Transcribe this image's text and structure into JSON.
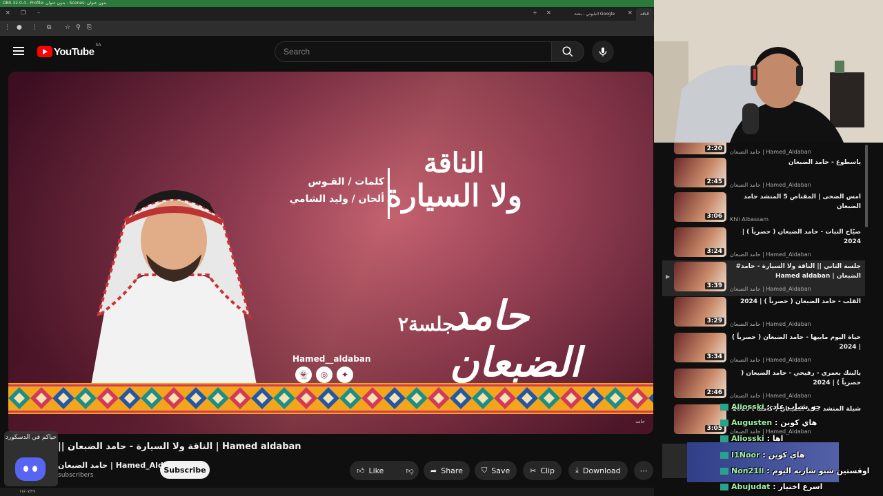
{
  "obs": {
    "title": "OBS 32.0.4 - Profile: بدون عنوان - Scenes: بدون عنوان"
  },
  "browser": {
    "tabs": [
      {
        "label": "البابوتي - بحث Google",
        "close": "×"
      },
      {
        "label": "الناقة",
        "close": "×"
      }
    ],
    "new_tab": "+"
  },
  "youtube": {
    "logo_text": "YouTube",
    "country_code": "SA",
    "search_placeholder": "Search"
  },
  "video": {
    "art": {
      "title_line1": "الناقة",
      "title_line2": "ولا السيارة",
      "credit_lyrics": "كلمات / القـوس",
      "credit_music": "ألحان / وليد الشامي",
      "signature": "حامد الضبعان",
      "session": "جلسة٢",
      "handle": "Hamed__aldaban",
      "watermark": "حامد"
    },
    "title": "|| الناقة ولا السيارة - حامد الضبعان | Hamed aldaban",
    "channel_name": "حامد الضبعان | Hamed_Aldaban",
    "channel_subs": "subscribers",
    "subscribe_label": "Subscribe",
    "actions": {
      "like": "Like",
      "share": "Share",
      "save": "Save",
      "clip": "Clip",
      "download": "Download",
      "more": "⋯"
    }
  },
  "discord": {
    "text": "حياكم في الدسكورد"
  },
  "taskbar": {
    "date": "١٧/٠٧/٢٧"
  },
  "recommendations": [
    {
      "title": "",
      "channel": "حامد الضبعان | Hamed_Aldaban",
      "duration": "2:20"
    },
    {
      "title": "ياسطوع - حامد الضبعان",
      "channel": "حامد الضبعان | Hamed_Aldaban",
      "duration": "2:45"
    },
    {
      "title": "امس الضحى | المقناص 5 المنشد حامد الضبعان",
      "channel": "Khli Albassam",
      "duration": "3:06"
    },
    {
      "title": "صيّاح النبات - حامد الضبعان ( حصرياً ) | 2024",
      "channel": "حامد الضبعان | Hamed_Aldaban",
      "duration": "3:24"
    },
    {
      "title": "جلسة الثاني || الناقة ولا السيارة - حامد# الضبعان | Hamed aldaban",
      "channel": "حامد الضبعان | Hamed_Aldaban",
      "duration": "3:39",
      "active": true
    },
    {
      "title": "القلب - حامد الضبعان ( حصرياً ) | 2024",
      "channel": "حامد الضبعان | Hamed_Aldaban",
      "duration": "3:29"
    },
    {
      "title": "حياة اليوم مابيها - حامد الضبعان ( حصرياً ) | 2024",
      "channel": "حامد الضبعان | Hamed_Aldaban",
      "duration": "3:34"
    },
    {
      "title": "يالبنك بعمري - رفيحي - حامد الضبعان ( حصرياً ) | 2024",
      "channel": "حامد الضبعان | Hamed_Aldaban",
      "duration": "2:46"
    },
    {
      "title": "شيلة المنشد حامد الضبعان ( كاملة ) 2020",
      "channel": "حامد الضبعان | Hamed_Aldaban",
      "duration": "3:05"
    }
  ],
  "chat": [
    {
      "user": "Aliosski",
      "text": ": جو شباب عاد"
    },
    {
      "user": "Augusten",
      "text": ": هاي كوين"
    },
    {
      "user": "Aliosski",
      "text": ": اها"
    },
    {
      "user": "I1Noor",
      "text": ": هاي كوين"
    },
    {
      "user": "Non21ll",
      "text": ": اوقستين شنو شاربه اليوم"
    },
    {
      "user": "Abujudat",
      "text": ": اسرع اختيار"
    }
  ],
  "colors": {
    "yt_red": "#ff0000",
    "bg": "#0f0f0f",
    "pill": "#272727",
    "discord": "#5865f2",
    "chat_user": "#9ff0a6"
  }
}
